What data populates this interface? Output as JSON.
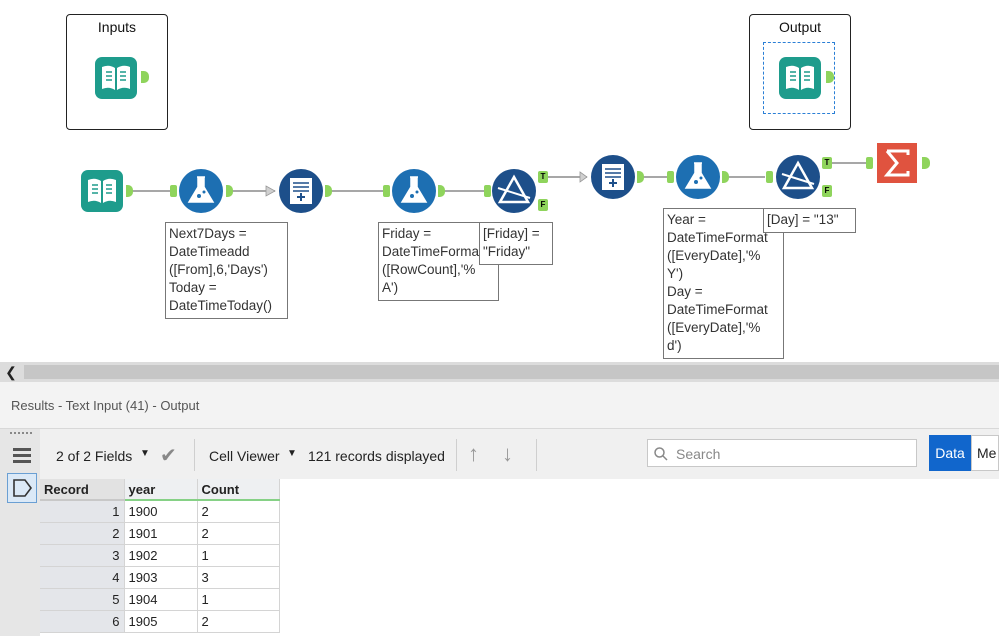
{
  "canvas": {
    "containers": [
      {
        "title": "Inputs"
      },
      {
        "title": "Output"
      }
    ],
    "tools": [
      {
        "kind": "book-icon"
      },
      {
        "kind": "formula-icon"
      },
      {
        "kind": "append-icon"
      },
      {
        "kind": "formula-icon"
      },
      {
        "kind": "filter-icon"
      },
      {
        "kind": "append-icon"
      },
      {
        "kind": "formula-icon"
      },
      {
        "kind": "filter-icon"
      },
      {
        "kind": "summarize-icon"
      }
    ],
    "annotations": [
      {
        "text": "Next7Days =\nDateTimeadd\n([From],6,'Days')\nToday =\nDateTimeToday()"
      },
      {
        "text": "Friday =\nDateTimeForma\n([RowCount],'%\nA')"
      },
      {
        "text": "[Friday] =\n\"Friday\""
      },
      {
        "text": "Year =\nDateTimeFormat\n([EveryDate],'%\nY')\nDay =\nDateTimeFormat\n([EveryDate],'%\nd')"
      },
      {
        "text": "[Day] = \"13\""
      }
    ],
    "anchor_labels": {
      "true": "T",
      "false": "F"
    }
  },
  "results": {
    "title": "Results - Text Input (41) - Output",
    "fields_label": "2 of 2 Fields",
    "cell_viewer_label": "Cell Viewer",
    "records_label": "121 records displayed",
    "search_placeholder": "Search",
    "data_tab": "Data",
    "meta_tab": "Me",
    "columns": [
      "Record",
      "year",
      "Count"
    ],
    "rows": [
      [
        "1",
        "1900",
        "2"
      ],
      [
        "2",
        "1901",
        "2"
      ],
      [
        "3",
        "1902",
        "1"
      ],
      [
        "4",
        "1903",
        "3"
      ],
      [
        "5",
        "1904",
        "1"
      ],
      [
        "6",
        "1905",
        "2"
      ]
    ]
  },
  "colors": {
    "input_tool": "#1e9c8c",
    "formula_tool": "#1d6fb2",
    "summarize_tool": "#e0533f",
    "anchor": "#8fd45c",
    "accent": "#1166cc",
    "header_underline": "#86d186"
  }
}
